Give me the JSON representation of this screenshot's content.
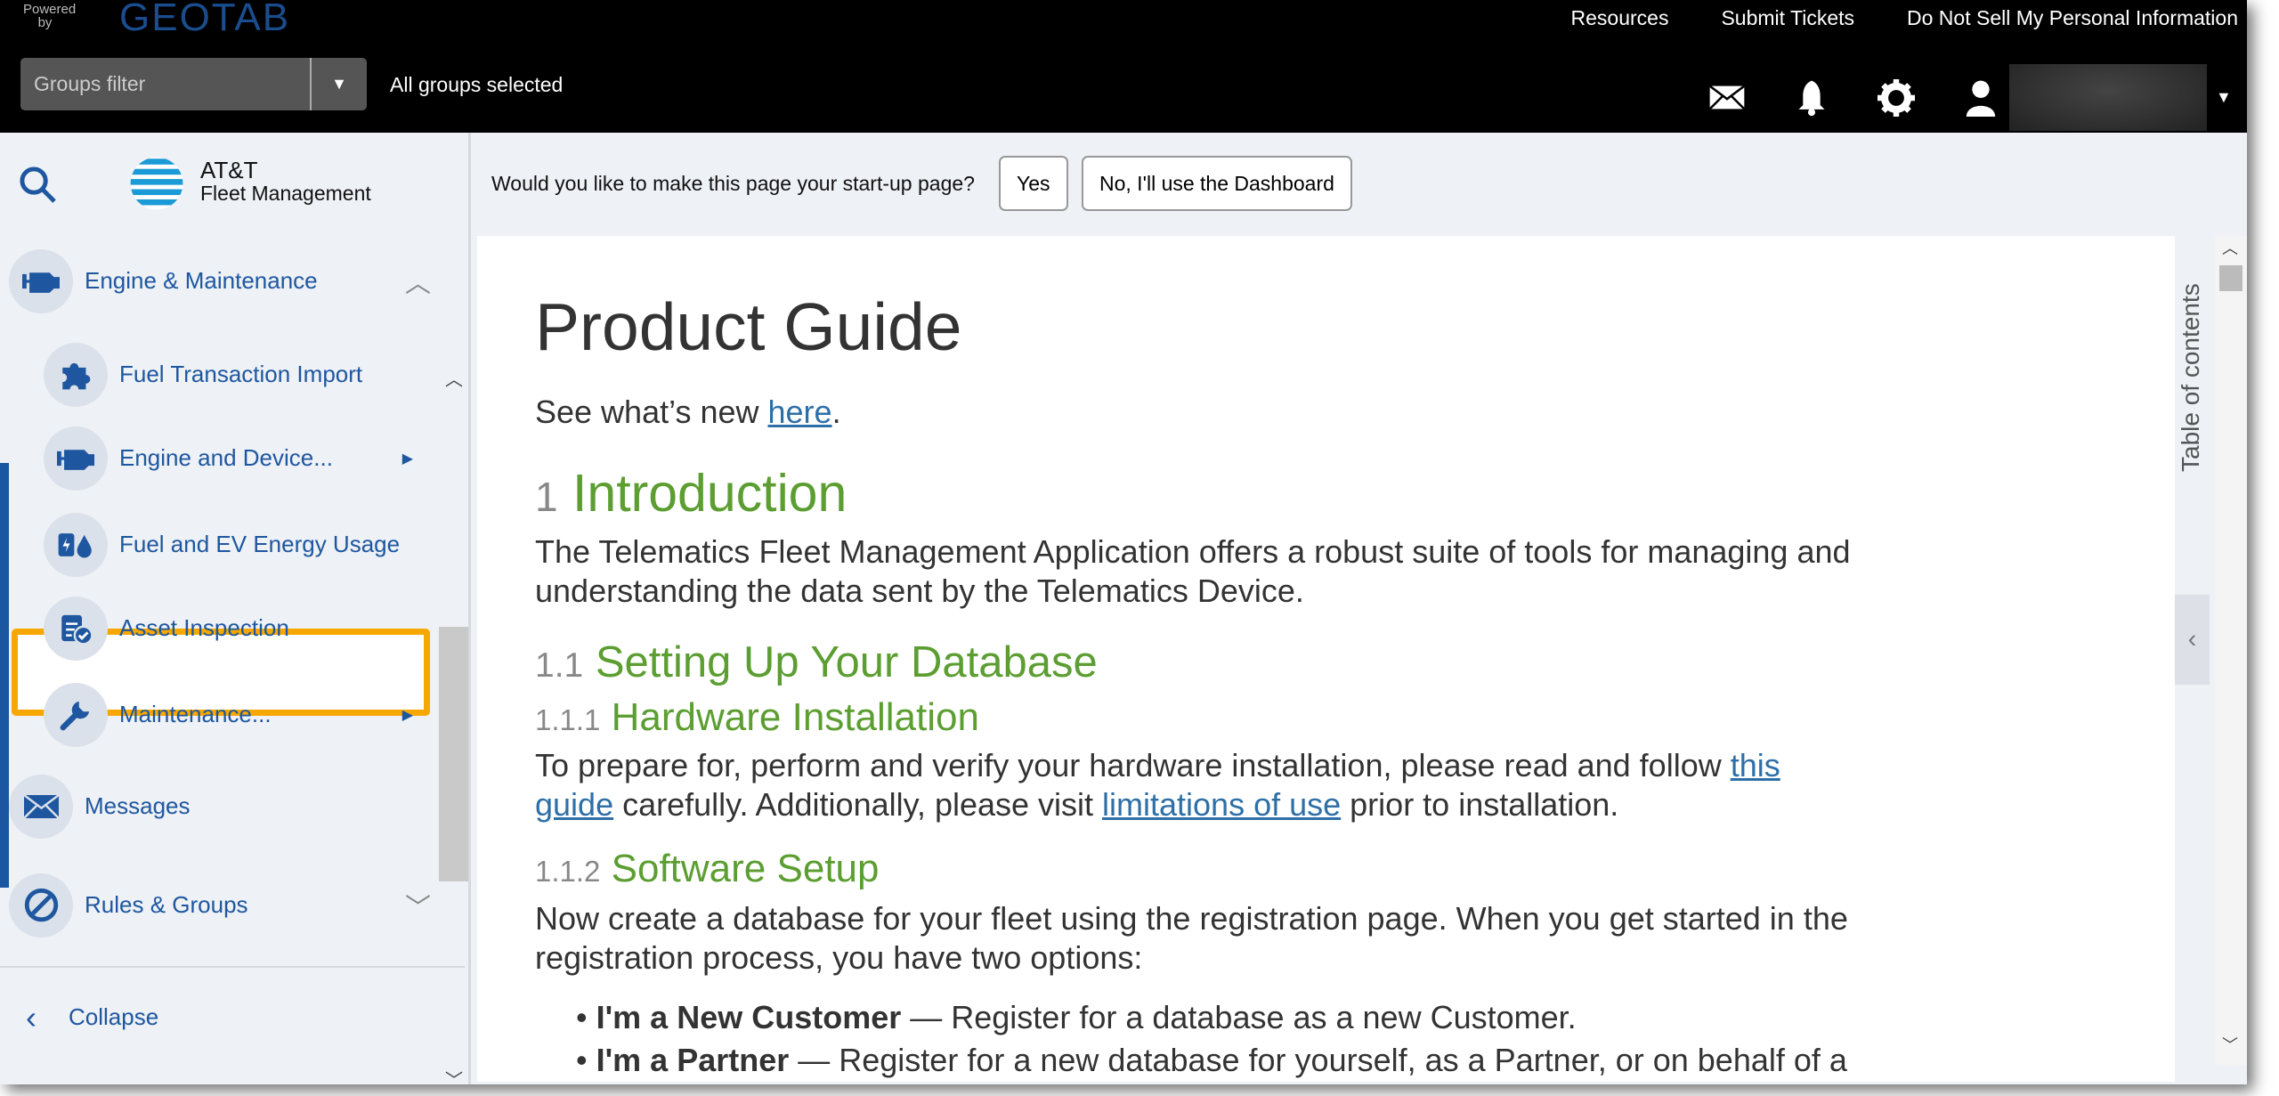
{
  "header": {
    "powered_by": "Powered by",
    "brand": "GEOTAB",
    "links": [
      "Resources",
      "Submit Tickets",
      "Do Not Sell My Personal Information"
    ],
    "groups_filter_placeholder": "Groups filter",
    "groups_status": "All groups selected",
    "icons": [
      "mail-icon",
      "bell-icon",
      "gear-icon",
      "user-icon"
    ]
  },
  "sidebar": {
    "logo_line1": "AT&T",
    "logo_line2": "Fleet Management",
    "section": "Engine & Maintenance",
    "subitems": [
      {
        "label": "Fuel Transaction Import",
        "icon": "puzzle-icon"
      },
      {
        "label": "Engine and Device...",
        "icon": "engine-icon"
      },
      {
        "label": "Fuel and EV Energy Usage",
        "icon": "fuel-ev-icon"
      },
      {
        "label": "Asset Inspection",
        "icon": "clipboard-check-icon"
      },
      {
        "label": "Maintenance...",
        "icon": "wrench-icon"
      }
    ],
    "messages": "Messages",
    "rules": "Rules & Groups",
    "collapse": "Collapse"
  },
  "startup": {
    "question": "Would you like to make this page your start-up page?",
    "yes": "Yes",
    "no": "No, I'll use the Dashboard"
  },
  "doc": {
    "title": "Product Guide",
    "whatsnew_pre": "See what’s new ",
    "whatsnew_link": "here",
    "whatsnew_post": ".",
    "s1_num": "1",
    "s1_title": "Introduction",
    "s1_text1": "The Telematics Fleet Management Application offers a robust suite of tools for managing and",
    "s1_text2": "understanding the data sent by the Telematics Device.",
    "s11_num": "1.1",
    "s11_title": "Setting Up Your Database",
    "s111_num": "1.1.1",
    "s111_title": "Hardware Installation",
    "s111_pre": "To prepare for, perform and verify your hardware installation, please read and follow ",
    "s111_link1a": "this",
    "s111_link1b": "guide",
    "s111_mid": " carefully. Additionally, please visit ",
    "s111_link2": "limitations of use",
    "s111_post": " prior to installation.",
    "s112_num": "1.1.2",
    "s112_title": "Software Setup",
    "s112_text1": "Now create a database for your fleet using the registration page. When you get started in the",
    "s112_text2": "registration process, you have two options:",
    "opt1_bold": "I'm a New Customer",
    "opt1_text": " — Register for a database as a new Customer.",
    "opt2_bold": "I'm a Partner",
    "opt2_text": " — Register for a new database for yourself, as a Partner, or on behalf of a"
  },
  "toc_label": "Table of contents",
  "colors": {
    "accent": "#1e57a0",
    "heading_green": "#5c9e31",
    "highlight": "#f7a800",
    "link": "#2e6fa7"
  }
}
